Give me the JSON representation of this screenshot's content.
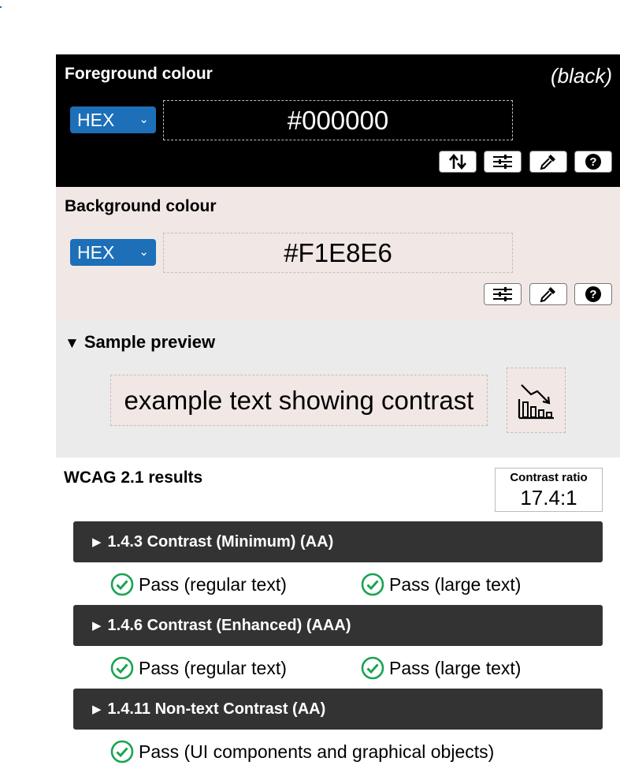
{
  "foreground": {
    "title": "Foreground colour",
    "colour_name": "(black)",
    "format": "HEX",
    "value": "#000000",
    "color_hex": "#000000"
  },
  "background": {
    "title": "Background colour",
    "format": "HEX",
    "value": "#F1E8E6",
    "color_hex": "#F1E8E6"
  },
  "preview": {
    "toggle_label": "Sample preview",
    "sample_text": "example text showing contrast"
  },
  "results": {
    "title": "WCAG 2.1 results",
    "contrast_label": "Contrast ratio",
    "contrast_value": "17.4:1",
    "criteria": [
      {
        "label": "1.4.3 Contrast (Minimum) (AA)",
        "results": [
          "Pass (regular text)",
          "Pass (large text)"
        ]
      },
      {
        "label": "1.4.6 Contrast (Enhanced) (AAA)",
        "results": [
          "Pass (regular text)",
          "Pass (large text)"
        ]
      },
      {
        "label": "1.4.11 Non-text Contrast (AA)",
        "results": [
          "Pass (UI components and graphical objects)"
        ]
      }
    ]
  },
  "icons": {
    "swap": "swap-arrows-icon",
    "adjust": "sliders-icon",
    "picker": "eyedropper-icon",
    "help": "help-icon",
    "pass": "check-circle-icon",
    "chart": "bar-chart-down-icon"
  },
  "colors": {
    "accent": "#1D6FB8",
    "pass_green": "#1AA350",
    "criterion_bg": "#333333"
  }
}
